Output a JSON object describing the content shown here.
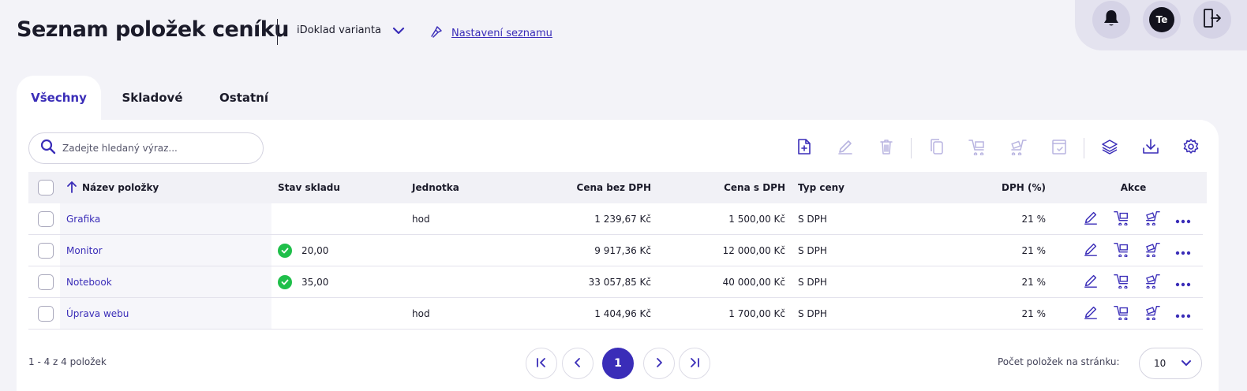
{
  "header": {
    "title": "Seznam položek ceníku",
    "variant_label": "iDoklad varianta",
    "settings_link": "Nastavení seznamu",
    "avatar_initials": "Te"
  },
  "tabs": [
    {
      "label": "Všechny",
      "active": true
    },
    {
      "label": "Skladové",
      "active": false
    },
    {
      "label": "Ostatní",
      "active": false
    }
  ],
  "search": {
    "placeholder": "Zadejte hledaný výraz..."
  },
  "toolbar": {
    "icons": [
      "add-document-icon",
      "edit-icon",
      "delete-icon",
      "copy-icon",
      "sell-icon",
      "purchase-icon",
      "stock-movement-icon",
      "layers-icon",
      "download-icon",
      "settings-icon"
    ]
  },
  "table": {
    "columns": {
      "name": "Název položky",
      "stock": "Stav skladu",
      "unit": "Jednotka",
      "price_no_vat": "Cena bez DPH",
      "price_vat": "Cena s DPH",
      "price_type": "Typ ceny",
      "vat": "DPH (%)",
      "actions": "Akce"
    },
    "sort": {
      "column": "name",
      "direction": "ascending"
    },
    "rows": [
      {
        "name": "Grafika",
        "stock": "",
        "unit": "hod",
        "price_no_vat": "1 239,67 Kč",
        "price_vat": "1 500,00 Kč",
        "price_type": "S DPH",
        "vat": "21 %"
      },
      {
        "name": "Monitor",
        "stock": "20,00",
        "unit": "",
        "price_no_vat": "9 917,36 Kč",
        "price_vat": "12 000,00 Kč",
        "price_type": "S DPH",
        "vat": "21 %"
      },
      {
        "name": "Notebook",
        "stock": "35,00",
        "unit": "",
        "price_no_vat": "33 057,85 Kč",
        "price_vat": "40 000,00 Kč",
        "price_type": "S DPH",
        "vat": "21 %"
      },
      {
        "name": "Úprava webu",
        "stock": "",
        "unit": "hod",
        "price_no_vat": "1 404,96 Kč",
        "price_vat": "1 700,00 Kč",
        "price_type": "S DPH",
        "vat": "21 %"
      }
    ]
  },
  "footer": {
    "count": "1 - 4 z 4 položek",
    "current_page": "1",
    "per_page_label": "Počet položek na stránku:",
    "per_page_value": "10"
  },
  "colors": {
    "accent": "#3a2db8",
    "success": "#1fbf4a",
    "background": "#f3f3f8"
  }
}
